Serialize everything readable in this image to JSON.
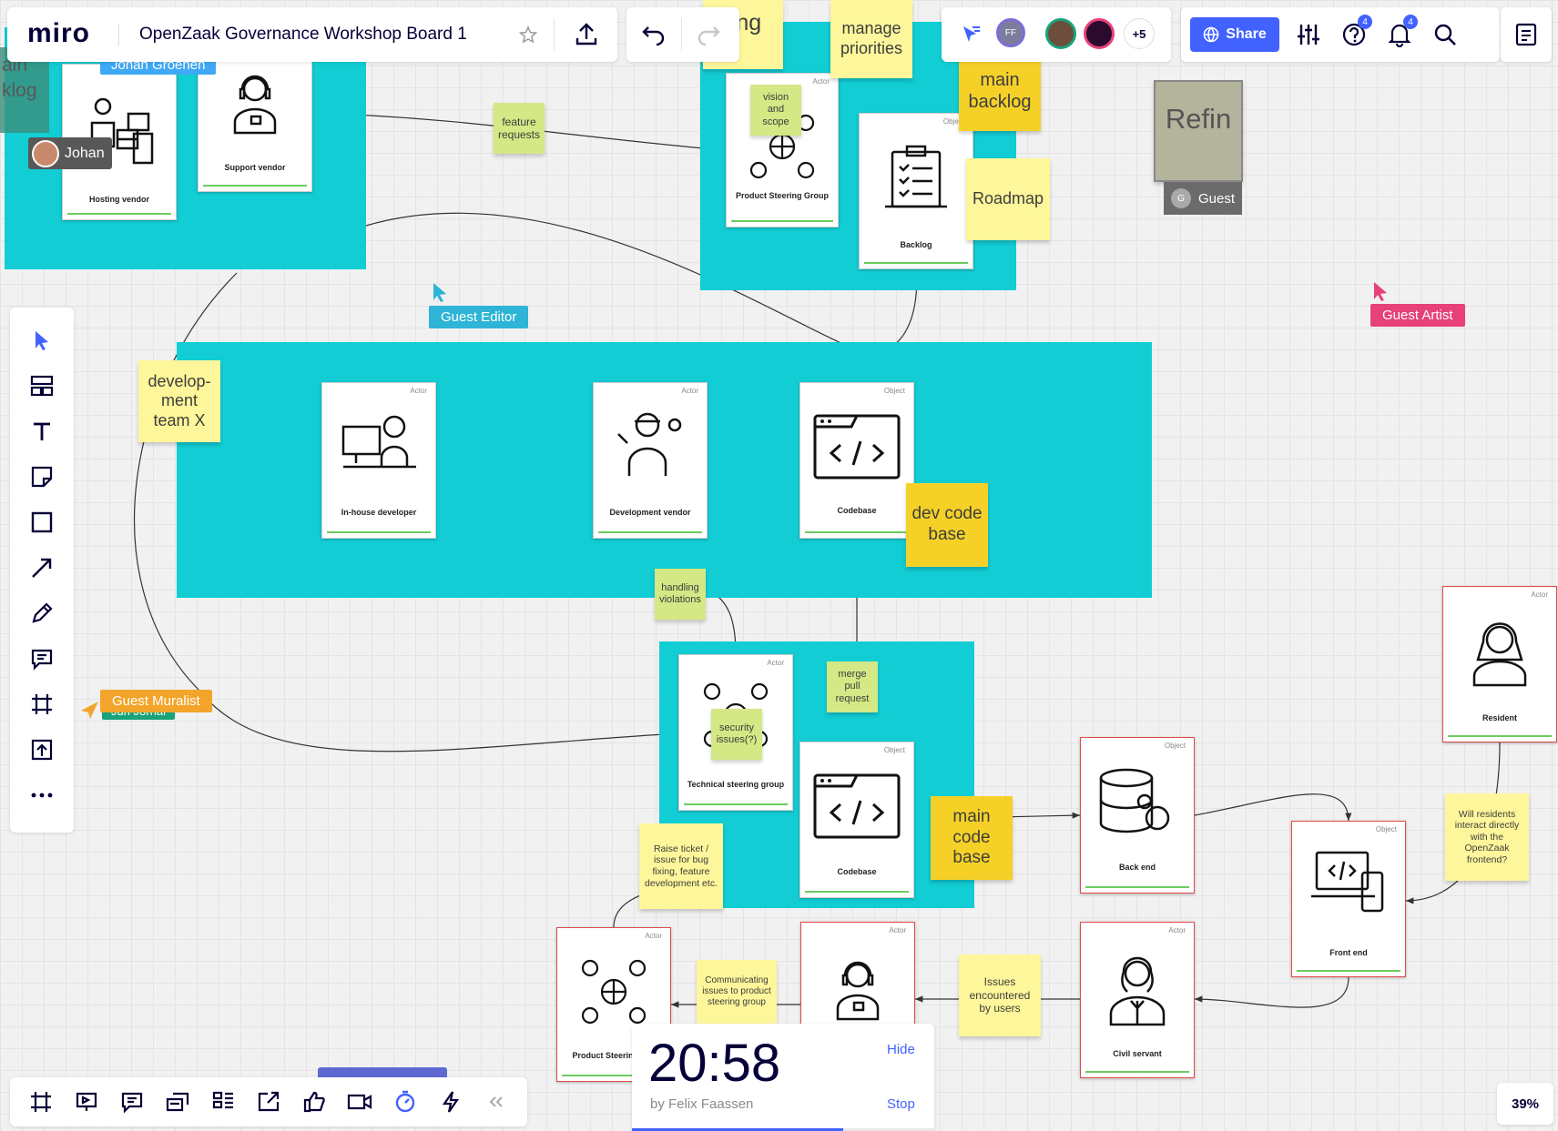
{
  "topbar": {
    "logo": "miro",
    "board_title": "OpenZaak Governance Workshop Board 1",
    "star_icon": "star-icon",
    "export_icon": "upload-icon",
    "undo_icon": "undo-icon",
    "redo_icon": "redo-icon",
    "collab_icon": "follow-cursor-icon",
    "avatar_ff": "FF",
    "more_users": "+5",
    "share_label": "Share",
    "help_badge": "4",
    "notif_badge": "4"
  },
  "frames": {
    "vendors_label": "Johan Groenen",
    "outside_text_1": "ain",
    "outside_text_2": "klog"
  },
  "cards": {
    "hosting": {
      "title": "Hosting vendor",
      "kind": ""
    },
    "support": {
      "title": "Support vendor",
      "kind": ""
    },
    "product_top": {
      "title": "Product Steering Group",
      "kind": "Actor"
    },
    "backlog": {
      "title": "Backlog",
      "kind": "Object"
    },
    "inhouse": {
      "title": "In-house developer",
      "kind": "Actor"
    },
    "devvendor": {
      "title": "Development vendor",
      "kind": "Actor"
    },
    "codebase1": {
      "title": "Codebase",
      "kind": "Object"
    },
    "techsteer": {
      "title": "Technical steering group",
      "kind": "Actor"
    },
    "codebase2": {
      "title": "Codebase",
      "kind": "Object"
    },
    "backend": {
      "title": "Back end",
      "kind": "Object"
    },
    "frontend": {
      "title": "Front end",
      "kind": "Object"
    },
    "resident": {
      "title": "Resident",
      "kind": "Actor"
    },
    "product_bottom": {
      "title": "Product Steering Gro",
      "kind": "Actor"
    },
    "support2": {
      "title": "",
      "kind": "Actor"
    },
    "civil": {
      "title": "Civil servant",
      "kind": "Actor"
    }
  },
  "stickies": {
    "ting": "ting",
    "manage": "manage priorities",
    "main_backlog": "main backlog",
    "refin": "Refin",
    "roadmap": "Roadmap",
    "feature": "feature requests",
    "vision": "vision and scope",
    "devteam": "develop-ment team X",
    "devcode": "dev code base",
    "handling": "handling violations",
    "merge": "merge pull request",
    "security": "security issues(?)",
    "maincode": "main code base",
    "raise": "Raise ticket / issue for bug fixing, feature development etc.",
    "communicating": "Communicating issues to product steering group",
    "issues": "Issues encountered by users",
    "residents_q": "Will residents interact directly with the OpenZaak frontend?"
  },
  "cursors": {
    "johan": "Johan",
    "guest": "Guest",
    "guest_initial": "G",
    "guest_editor": "Guest Editor",
    "guest_artist": "Guest Artist",
    "guest_muralist": "Guest Muralist",
    "muralist_shadow": "Juri Jornal"
  },
  "left_toolbar": [
    {
      "name": "select-tool",
      "icon": "cursor-icon"
    },
    {
      "name": "templates-tool",
      "icon": "templates-icon"
    },
    {
      "name": "text-tool",
      "icon": "text-icon"
    },
    {
      "name": "sticky-note-tool",
      "icon": "sticky-note-icon"
    },
    {
      "name": "shape-tool",
      "icon": "square-icon"
    },
    {
      "name": "connection-line-tool",
      "icon": "arrow-icon"
    },
    {
      "name": "pen-tool",
      "icon": "pen-icon"
    },
    {
      "name": "comment-tool",
      "icon": "comment-icon"
    },
    {
      "name": "frame-tool",
      "icon": "frame-icon"
    },
    {
      "name": "upload-tool",
      "icon": "upload-icon"
    },
    {
      "name": "more-tools",
      "icon": "more-icon"
    }
  ],
  "bottom_toolbar": [
    "frames-icon",
    "presentation-icon",
    "comments-icon",
    "cards-icon",
    "kanban-icon",
    "share-screen-icon",
    "voting-icon",
    "video-icon",
    "timer-icon",
    "lightning-icon",
    "collapse-icon"
  ],
  "timer": {
    "time": "20:58",
    "by": "by Felix Faassen",
    "hide": "Hide",
    "stop": "Stop",
    "progress": 0.7
  },
  "zoom": "39%",
  "colors": {
    "frame": "#12cdd4",
    "share": "#4262ff",
    "guest_editor": "#2db4d6",
    "guest_artist": "#e8407a",
    "guest_muralist": "#f3a52b",
    "johan_tag": "#3fa9f5"
  }
}
